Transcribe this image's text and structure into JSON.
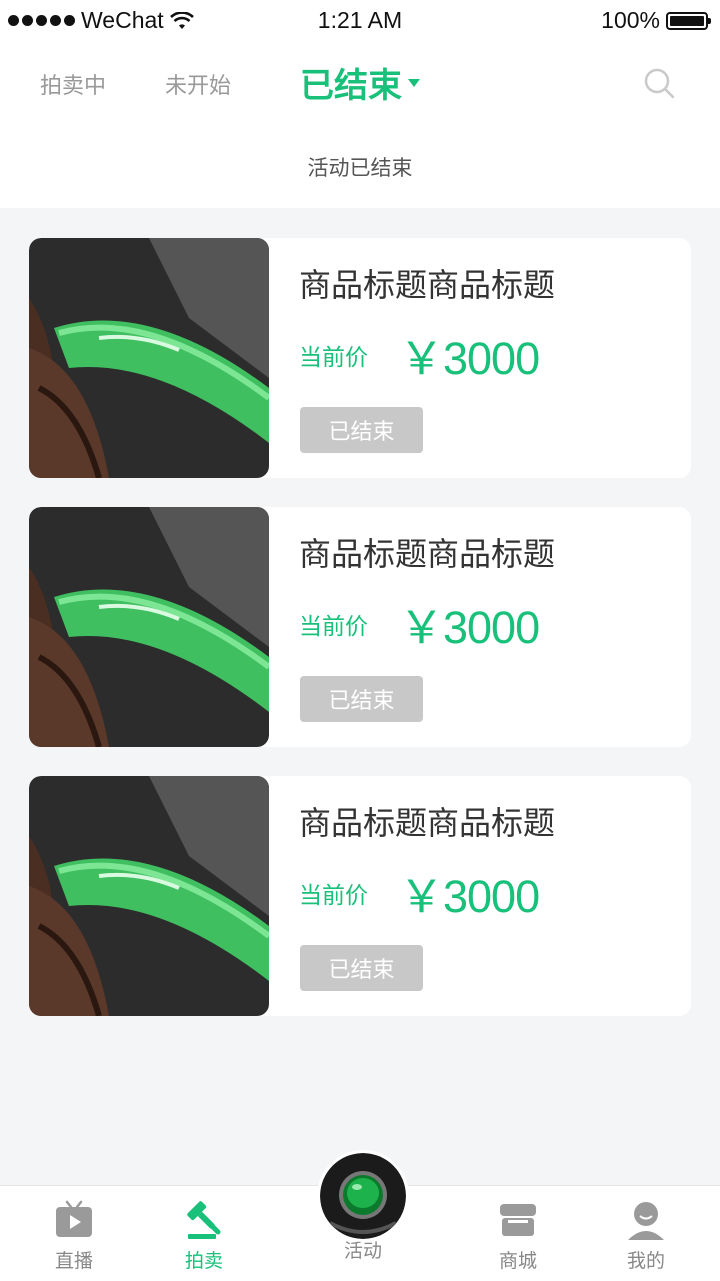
{
  "status_bar": {
    "carrier": "WeChat",
    "time": "1:21 AM",
    "battery": "100%"
  },
  "header": {
    "tabs": [
      {
        "label": "拍卖中",
        "active": false
      },
      {
        "label": "未开始",
        "active": false
      },
      {
        "label": "已结束",
        "active": true
      }
    ],
    "sub_status": "活动已结束"
  },
  "items": [
    {
      "title": "商品标题商品标题",
      "price_label": "当前价",
      "price": "￥3000",
      "status_button": "已结束"
    },
    {
      "title": "商品标题商品标题",
      "price_label": "当前价",
      "price": "￥3000",
      "status_button": "已结束"
    },
    {
      "title": "商品标题商品标题",
      "price_label": "当前价",
      "price": "￥3000",
      "status_button": "已结束"
    }
  ],
  "bottom_nav": {
    "items": [
      {
        "label": "直播",
        "icon": "tv-icon"
      },
      {
        "label": "拍卖",
        "icon": "gavel-icon",
        "active": true
      },
      {
        "label": "活动",
        "icon": "jade-ring-icon"
      },
      {
        "label": "商城",
        "icon": "store-icon"
      },
      {
        "label": "我的",
        "icon": "user-icon"
      }
    ]
  },
  "colors": {
    "accent": "#19c07a",
    "muted": "#999999",
    "button_disabled": "#c8c8c8",
    "background": "#f4f5f7"
  }
}
